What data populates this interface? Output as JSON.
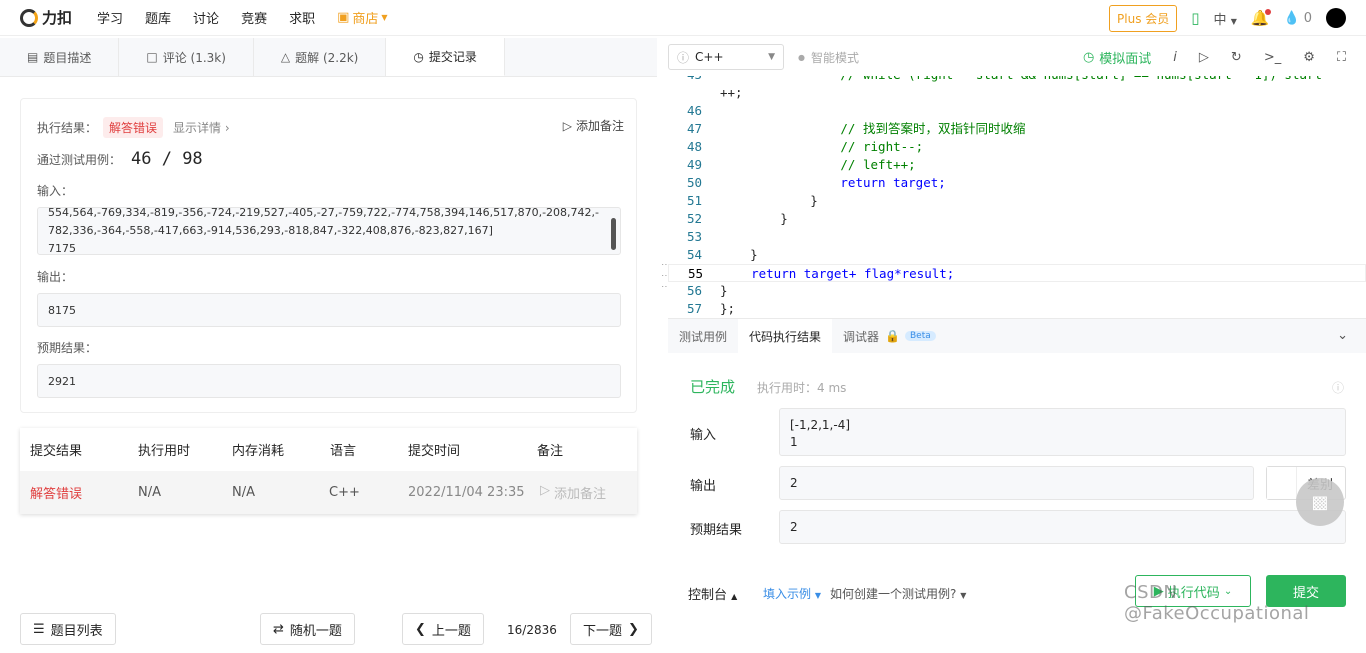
{
  "nav": {
    "logo": "力扣",
    "items": [
      "学习",
      "题库",
      "讨论",
      "竞赛",
      "求职"
    ],
    "store": "商店",
    "plus": "Plus 会员",
    "lang": "中",
    "fire_count": "0"
  },
  "left_tabs": [
    {
      "label": "题目描述"
    },
    {
      "label": "评论 (1.3k)"
    },
    {
      "label": "题解 (2.2k)"
    },
    {
      "label": "提交记录"
    }
  ],
  "result": {
    "label": "执行结果：",
    "status": "解答错误",
    "details": "显示详情 ›",
    "add_note": "添加备注",
    "pass_label": "通过测试用例：",
    "pass_value": "46 / 98",
    "input_label": "输入：",
    "input_line1": "554,564,-769,334,-819,-356,-724,-219,527,-405,-27,-759,722,-774,758,394,146,517,870,-208,742,-",
    "input_line2": "782,336,-364,-558,-417,663,-914,536,293,-818,847,-322,408,876,-823,827,167]",
    "input_line3": "7175",
    "output_label": "输出：",
    "output_value": "8175",
    "expected_label": "预期结果：",
    "expected_value": "2921"
  },
  "subs_table": {
    "headers": [
      "提交结果",
      "执行用时",
      "内存消耗",
      "语言",
      "提交时间",
      "备注"
    ],
    "row": [
      "解答错误",
      "N/A",
      "N/A",
      "C++",
      "2022/11/04 23:35",
      "添加备注"
    ]
  },
  "bottom_left": {
    "list": "题目列表",
    "random": "随机一题",
    "prev": "上一题",
    "page": "16/2836",
    "next": "下一题"
  },
  "editor": {
    "language": "C++",
    "smart_mode": "智能模式",
    "mock": "模拟面试"
  },
  "code_lines": [
    {
      "n": "",
      "text": "++;",
      "cls": ""
    },
    {
      "n": "46",
      "text": "",
      "cls": ""
    },
    {
      "n": "47",
      "text": "                // 找到答案时，双指针同时收缩",
      "cls": "cm"
    },
    {
      "n": "48",
      "text": "                // right--;",
      "cls": "cm"
    },
    {
      "n": "49",
      "text": "                // left++;",
      "cls": "cm"
    },
    {
      "n": "50",
      "text": "                return target;",
      "cls": "kwline"
    },
    {
      "n": "51",
      "text": "            }",
      "cls": ""
    },
    {
      "n": "52",
      "text": "        }",
      "cls": ""
    },
    {
      "n": "53",
      "text": "",
      "cls": ""
    },
    {
      "n": "54",
      "text": "    }",
      "cls": ""
    },
    {
      "n": "55",
      "text": "    return target+ flag*result;",
      "cls": "kwline"
    },
    {
      "n": "56",
      "text": "}",
      "cls": ""
    },
    {
      "n": "57",
      "text": "};",
      "cls": ""
    }
  ],
  "result_tabs": {
    "tab1": "测试用例",
    "tab2": "代码执行结果",
    "tab3": "调试器",
    "beta": "Beta"
  },
  "run_result": {
    "status": "已完成",
    "time": "执行用时：4 ms",
    "input_label": "输入",
    "input_line1": "[-1,2,1,-4]",
    "input_line2": "1",
    "output_label": "输出",
    "output_value": "2",
    "diff": "差别",
    "expected_label": "预期结果",
    "expected_value": "2"
  },
  "bottom_right": {
    "console": "控制台",
    "fill_example": "填入示例",
    "how_create": "如何创建一个测试用例?",
    "run": "执行代码",
    "submit": "提交"
  },
  "watermark": "CSDN @FakeOccupational",
  "colors": {
    "accent": "#2db55d",
    "error": "#e03e3e",
    "store": "#f0a020"
  }
}
